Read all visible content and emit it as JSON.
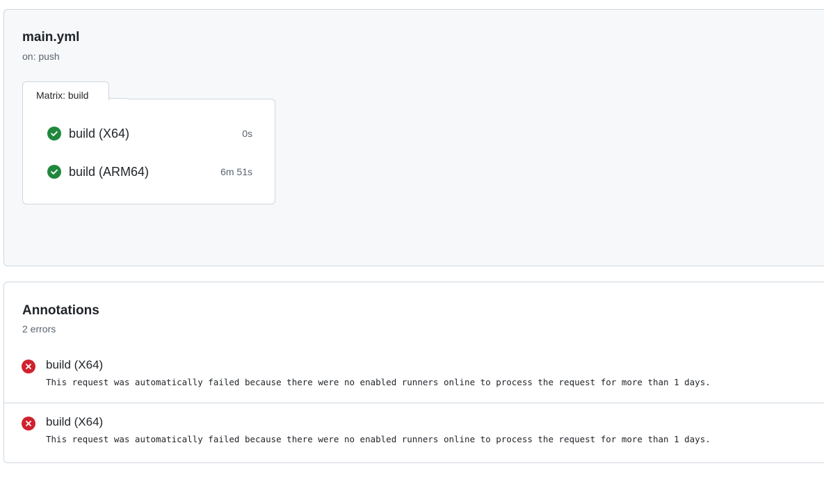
{
  "workflow": {
    "title": "main.yml",
    "trigger": "on: push",
    "matrix_label": "Matrix: build",
    "jobs": [
      {
        "name": "build (X64)",
        "duration": "0s",
        "status": "success"
      },
      {
        "name": "build (ARM64)",
        "duration": "6m 51s",
        "status": "success"
      }
    ]
  },
  "annotations": {
    "title": "Annotations",
    "count": "2 errors",
    "items": [
      {
        "job": "build (X64)",
        "message": "This request was automatically failed because there were no enabled runners online to process the request for more than 1 days.",
        "level": "error"
      },
      {
        "job": "build (X64)",
        "message": "This request was automatically failed because there were no enabled runners online to process the request for more than 1 days.",
        "level": "error"
      }
    ]
  },
  "colors": {
    "success": "#1f883d",
    "error": "#cf222e",
    "panel_bg": "#f6f8fa",
    "border": "#d0d7de"
  }
}
